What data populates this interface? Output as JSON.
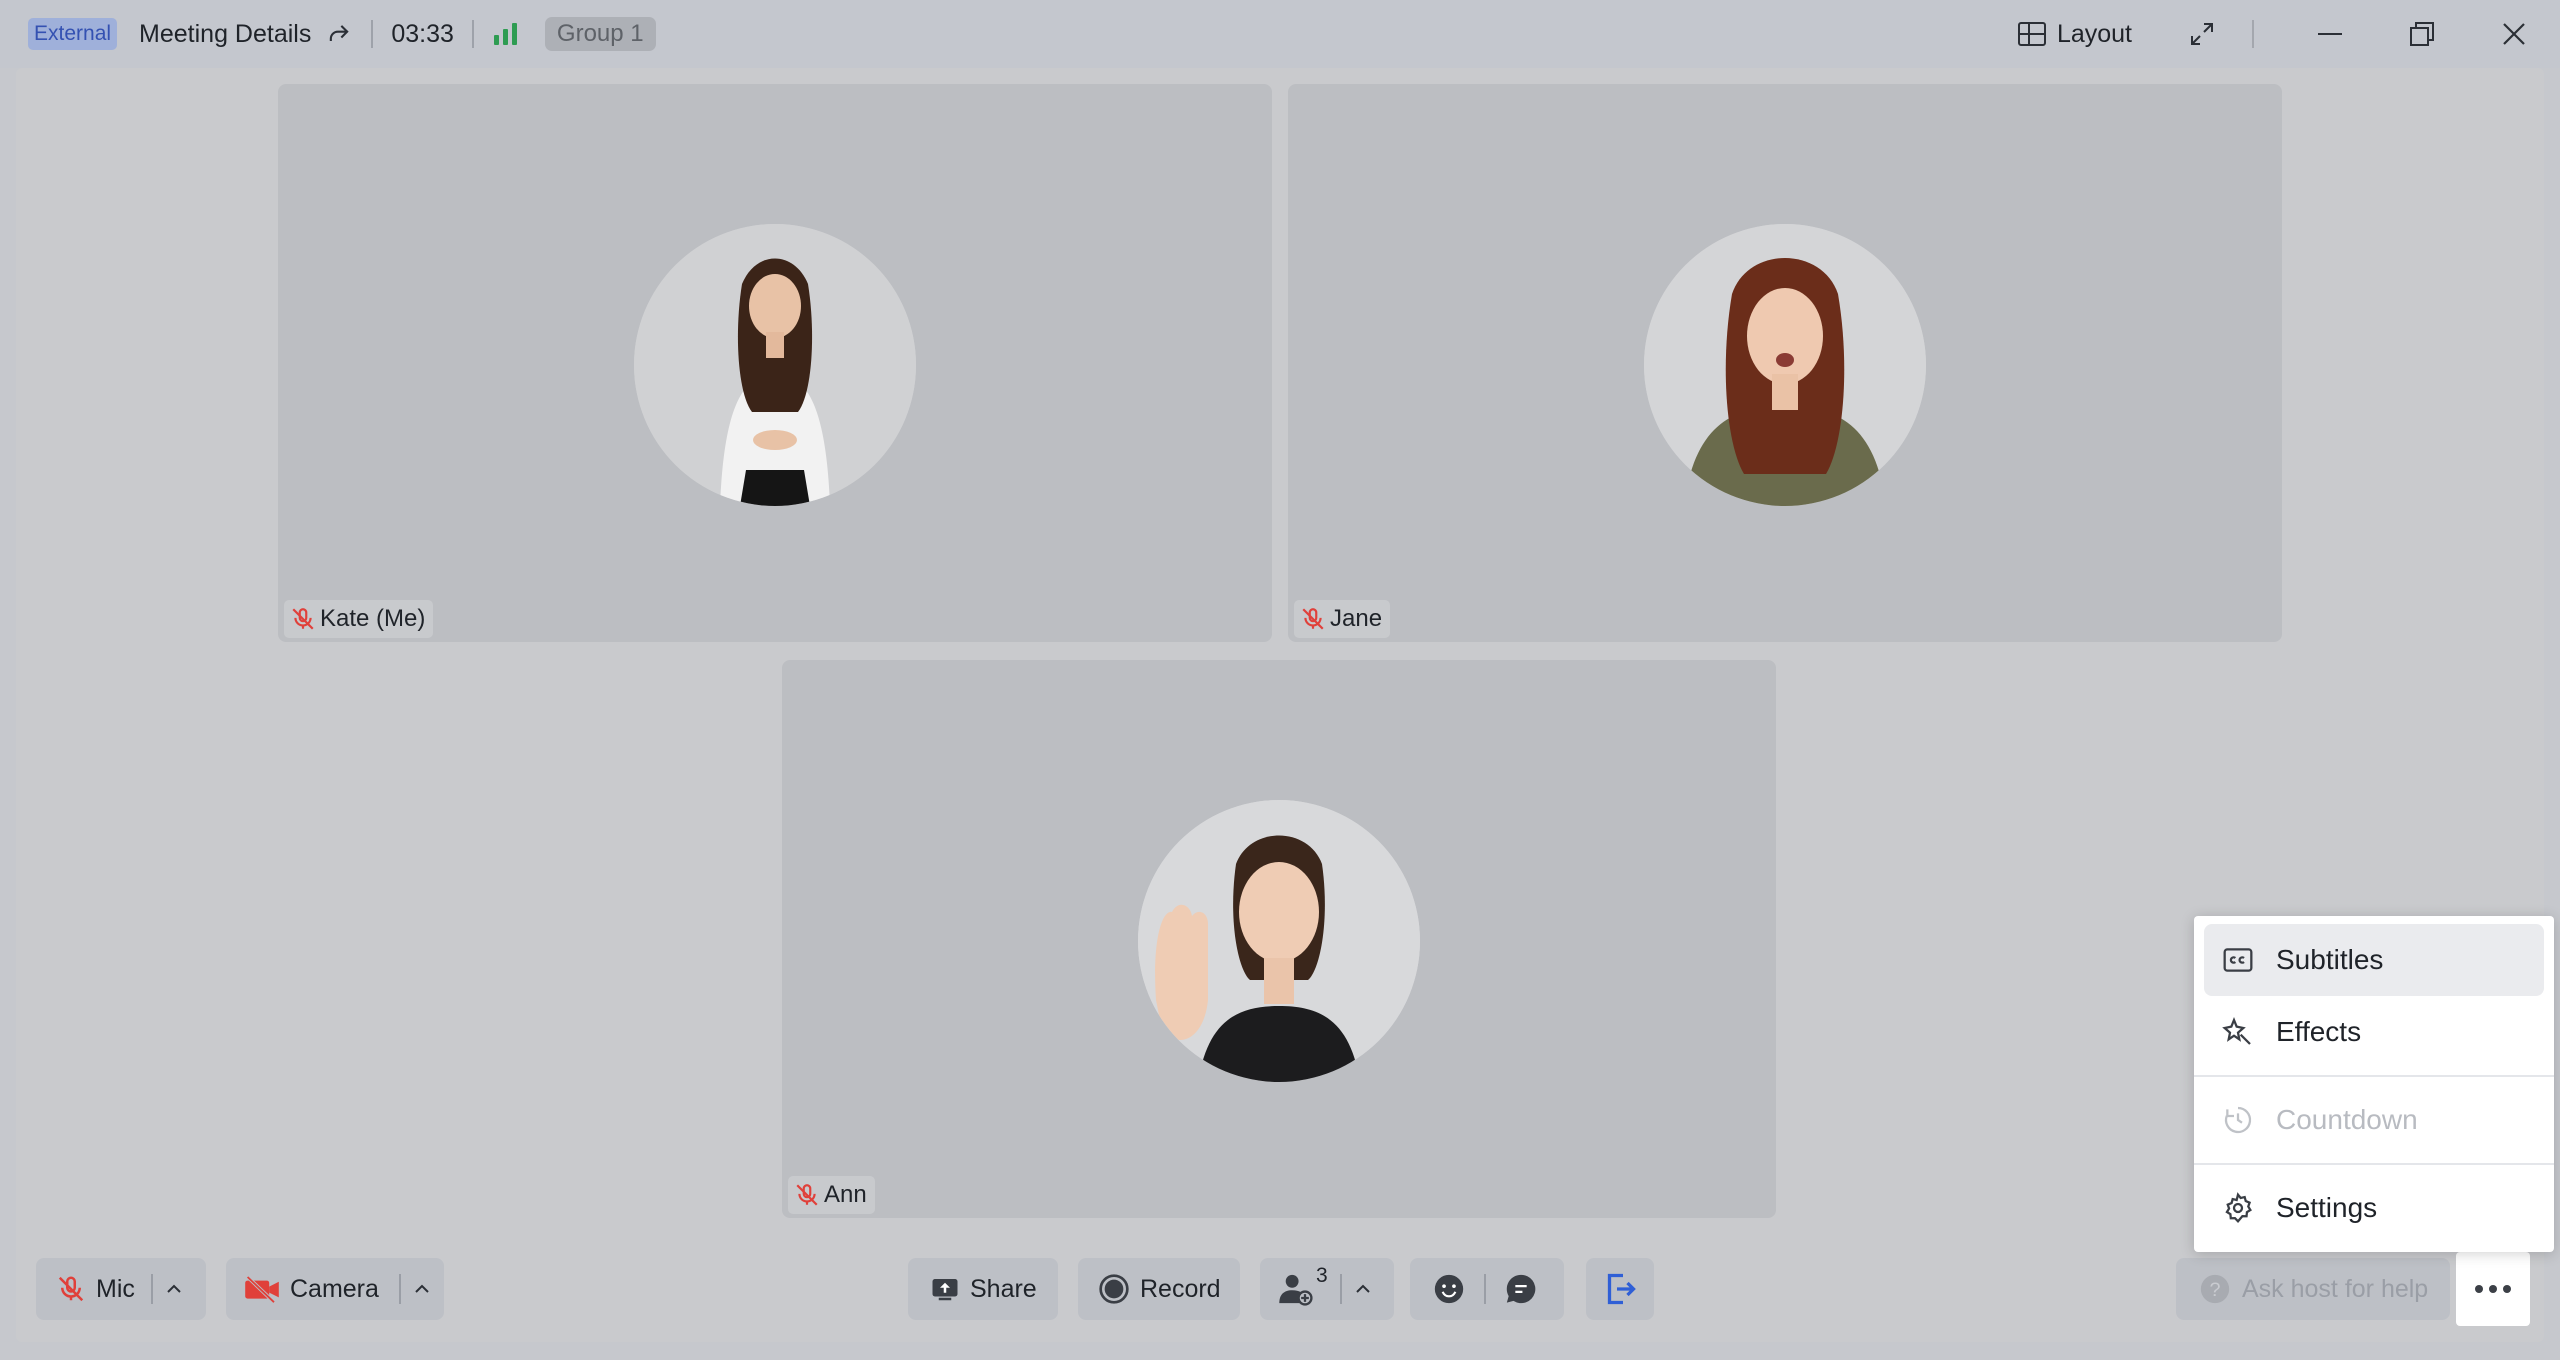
{
  "titlebar": {
    "badge": "External",
    "meeting_details": "Meeting Details",
    "timer": "03:33",
    "group": "Group 1",
    "layout_label": "Layout"
  },
  "participants": [
    {
      "name": "Kate (Me)",
      "muted": true
    },
    {
      "name": "Jane",
      "muted": true
    },
    {
      "name": "Ann",
      "muted": true
    }
  ],
  "toolbar": {
    "mic_label": "Mic",
    "camera_label": "Camera",
    "share_label": "Share",
    "record_label": "Record",
    "participant_count": "3",
    "help_label": "Ask host for help"
  },
  "more_menu": {
    "items": [
      {
        "label": "Subtitles",
        "icon": "cc-icon",
        "state": "hover"
      },
      {
        "label": "Effects",
        "icon": "effects-icon",
        "state": "enabled"
      },
      {
        "label": "Countdown",
        "icon": "timer-icon",
        "state": "disabled"
      },
      {
        "label": "Settings",
        "icon": "gear-icon",
        "state": "enabled"
      }
    ]
  },
  "colors": {
    "accent": "#2f5fd6",
    "mute_red": "#e0403a",
    "signal_green": "#2e9c52"
  }
}
